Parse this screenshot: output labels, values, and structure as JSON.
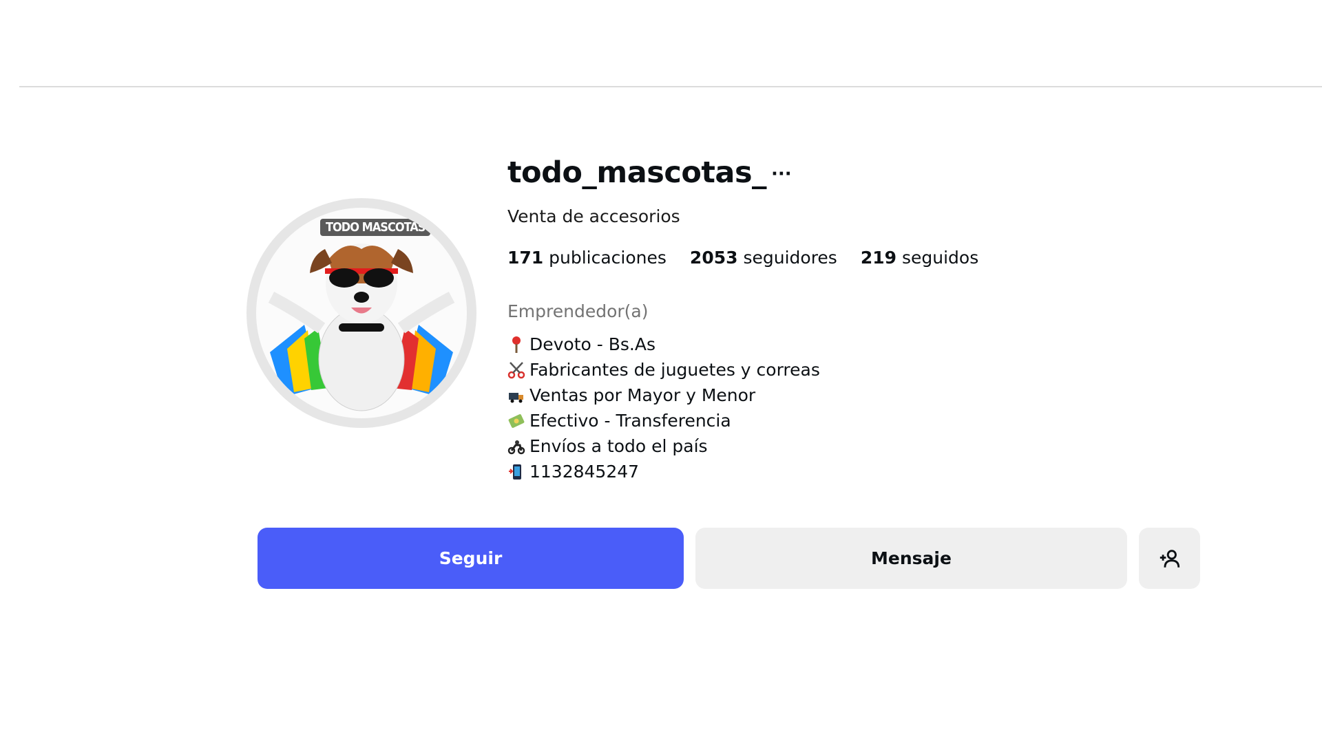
{
  "profile": {
    "username": "todo_mascotas_",
    "more_label": "···",
    "subtitle": "Venta de accesorios",
    "avatar_badge": "TODO MASCOTAS",
    "stats": [
      {
        "count": "171",
        "label": "publicaciones"
      },
      {
        "count": "2053",
        "label": "seguidores"
      },
      {
        "count": "219",
        "label": "seguidos"
      }
    ],
    "category": "Emprendedor(a)",
    "bio": [
      {
        "icon": "pin-icon",
        "text": "Devoto - Bs.As"
      },
      {
        "icon": "scissors-icon",
        "text": "Fabricantes de juguetes y correas"
      },
      {
        "icon": "truck-icon",
        "text": "Ventas por Mayor y Menor"
      },
      {
        "icon": "money-icon",
        "text": "Efectivo - Transferencia"
      },
      {
        "icon": "motorcycle-icon",
        "text": "Envíos a todo el país"
      },
      {
        "icon": "phone-icon",
        "text": "1132845247"
      }
    ]
  },
  "actions": {
    "follow_label": "Seguir",
    "message_label": "Mensaje",
    "suggest_icon": "add-user-icon"
  },
  "colors": {
    "follow_bg": "#4a5df9",
    "secondary_bg": "#efefef",
    "category_text": "#737373"
  }
}
